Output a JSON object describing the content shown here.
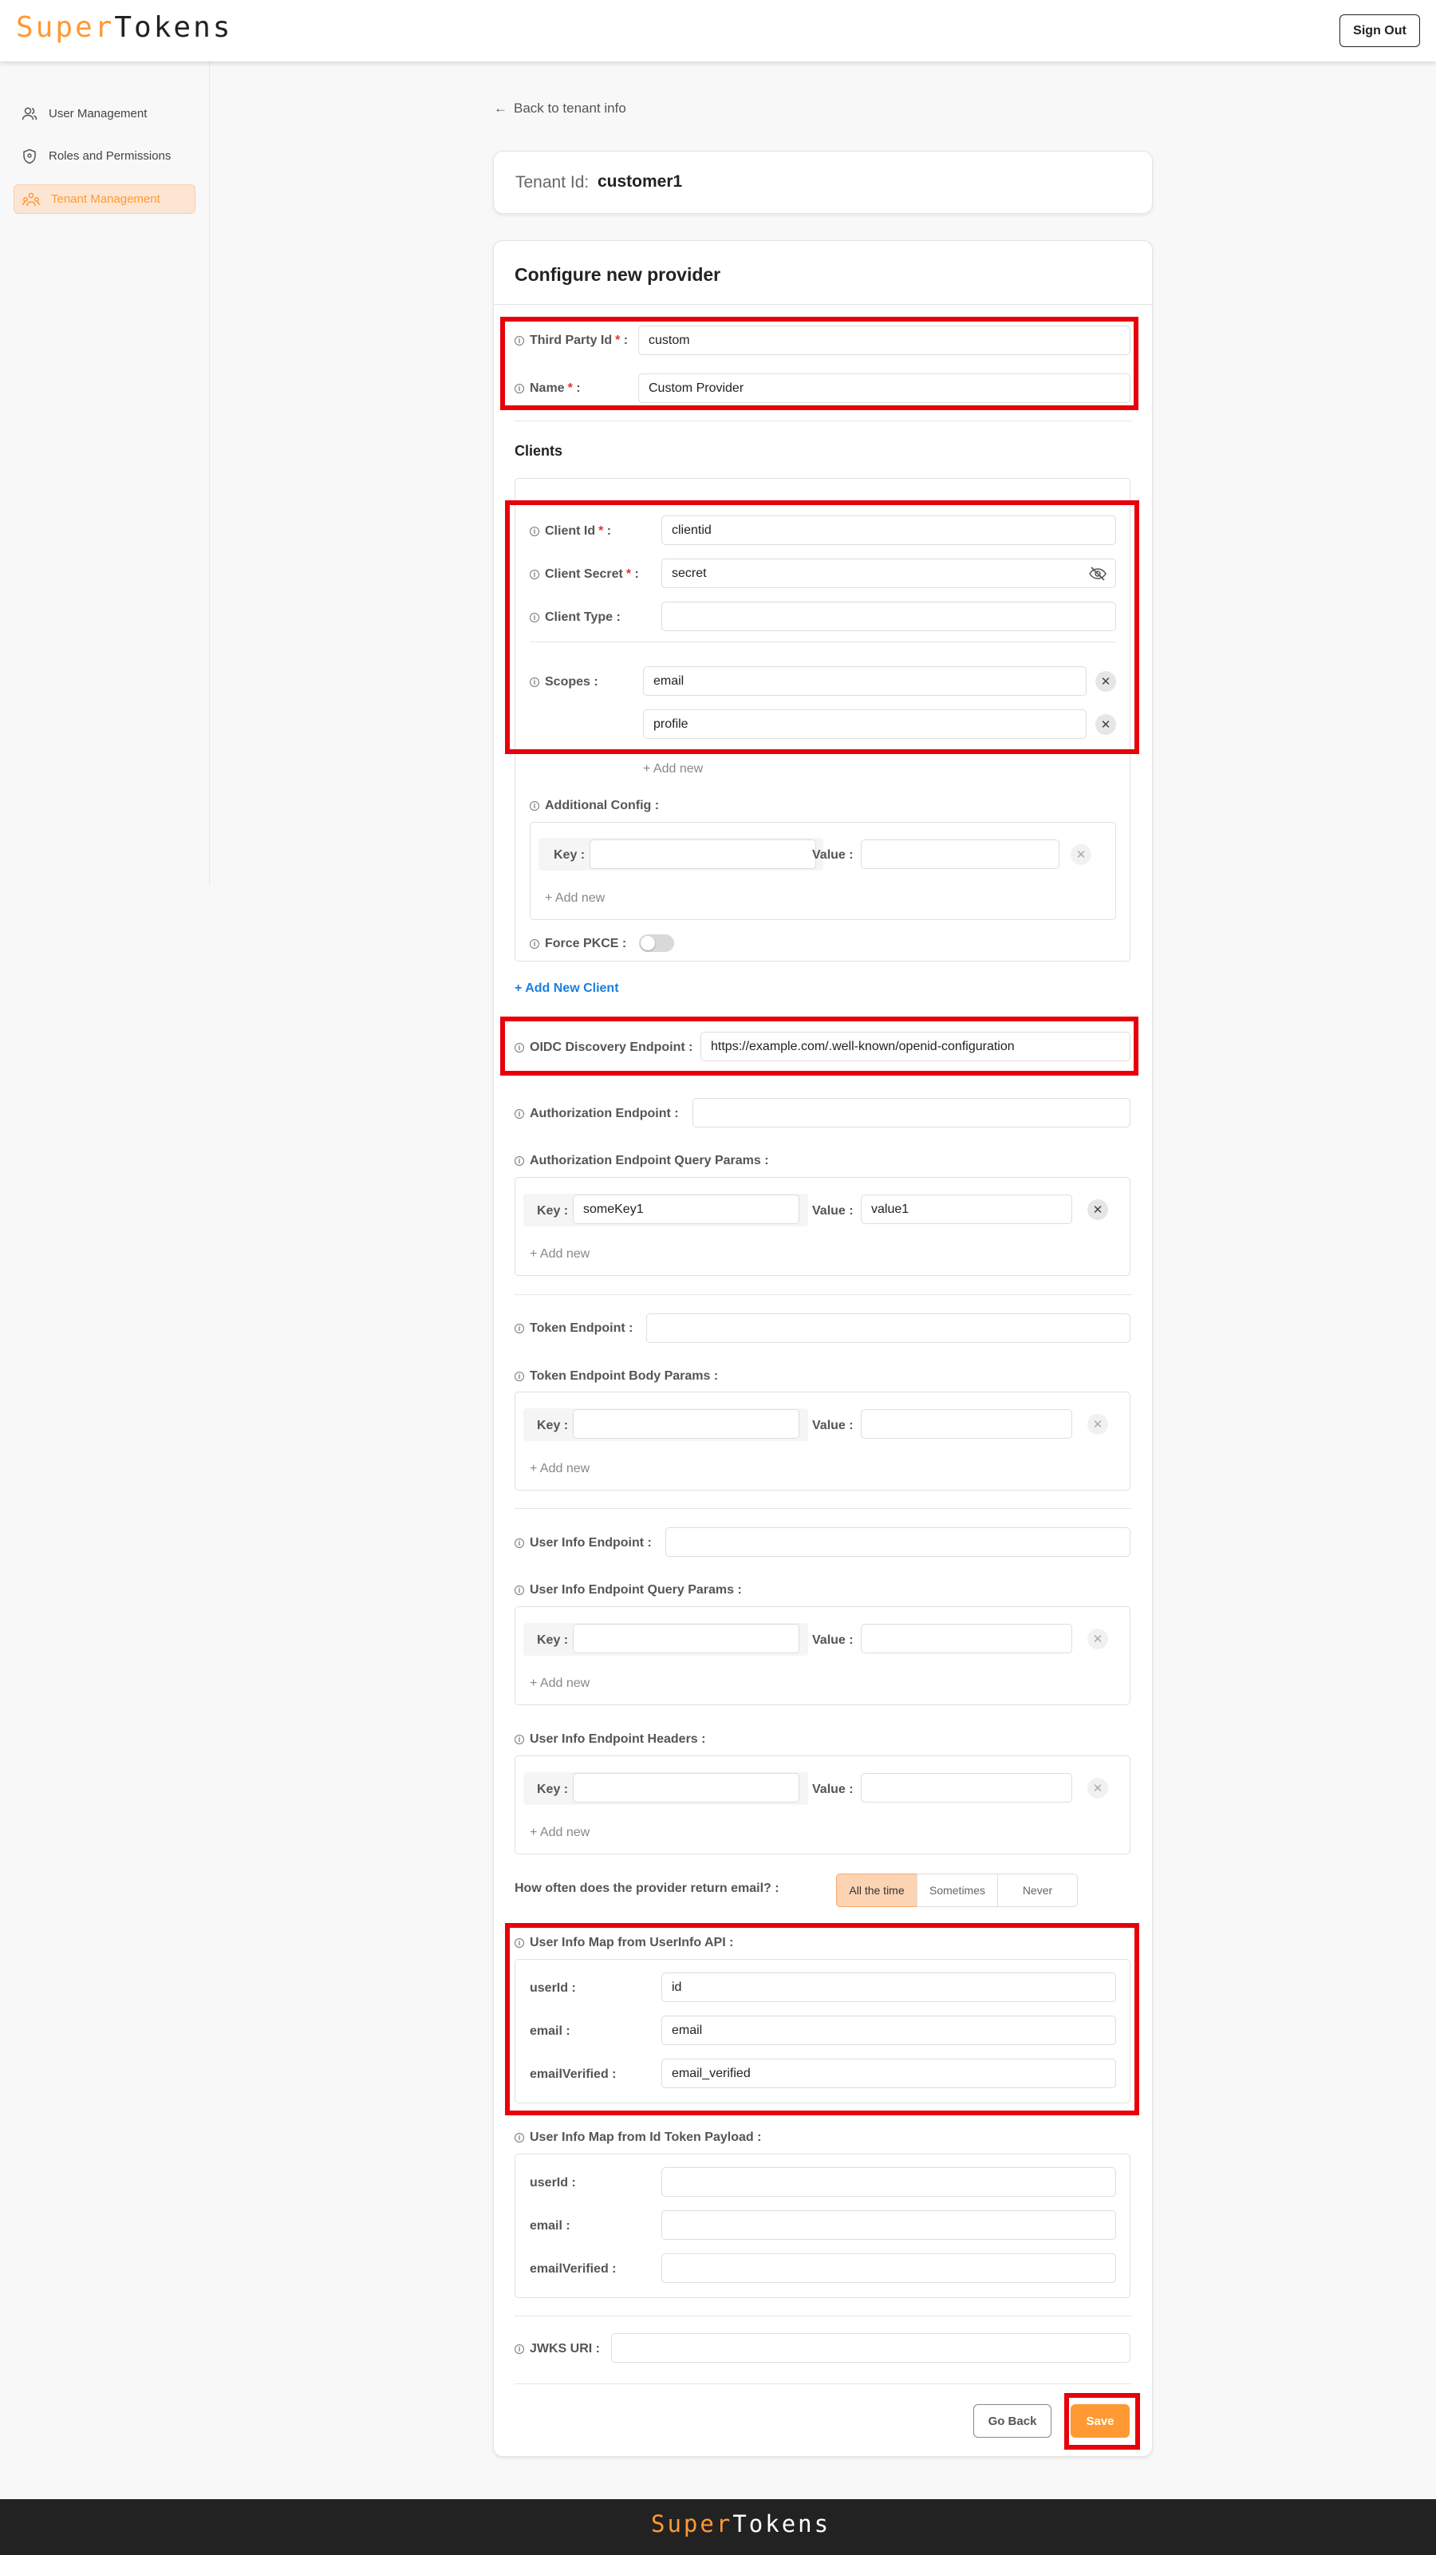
{
  "brand": {
    "super": "Super",
    "tokens": "Tokens"
  },
  "header": {
    "sign_out": "Sign Out"
  },
  "sidebar": {
    "items": [
      {
        "label": "User Management"
      },
      {
        "label": "Roles and Permissions"
      },
      {
        "label": "Tenant Management"
      }
    ]
  },
  "back_link": "Back to tenant info",
  "tenant": {
    "label": "Tenant Id:",
    "value": "customer1"
  },
  "form": {
    "title": "Configure new provider",
    "third_party_id": {
      "label": "Third Party Id",
      "value": "custom"
    },
    "name": {
      "label": "Name",
      "value": "Custom Provider"
    },
    "clients_heading": "Clients",
    "client": {
      "client_id": {
        "label": "Client Id",
        "value": "clientid"
      },
      "client_secret": {
        "label": "Client Secret",
        "value": "secret"
      },
      "client_type": {
        "label": "Client Type :",
        "value": ""
      },
      "scopes_label": "Scopes :",
      "scopes": [
        "email",
        "profile"
      ],
      "add_new": "+ Add new",
      "additional_config_label": "Additional Config :",
      "force_pkce_label": "Force PKCE :"
    },
    "add_new_client": "+ Add New Client",
    "oidc": {
      "label": "OIDC Discovery Endpoint :",
      "value": "https://example.com/.well-known/openid-configuration"
    },
    "authorization_endpoint_label": "Authorization Endpoint :",
    "authorization_query_params_label": "Authorization Endpoint Query Params :",
    "auth_param": {
      "key": "someKey1",
      "value": "value1"
    },
    "token_endpoint_label": "Token Endpoint :",
    "token_body_params_label": "Token Endpoint Body Params :",
    "user_info_endpoint_label": "User Info Endpoint :",
    "user_info_query_params_label": "User Info Endpoint Query Params :",
    "user_info_headers_label": "User Info Endpoint Headers :",
    "kv": {
      "key_label": "Key :",
      "value_label": "Value :"
    },
    "email_frequency": {
      "question": "How often does the provider return email? :",
      "options": [
        "All the time",
        "Sometimes",
        "Never"
      ],
      "selected": "All the time"
    },
    "userinfo_map": {
      "label": "User Info Map from UserInfo API :",
      "rows": [
        {
          "label": "userId :",
          "value": "id"
        },
        {
          "label": "email :",
          "value": "email"
        },
        {
          "label": "emailVerified :",
          "value": "email_verified"
        }
      ]
    },
    "idtoken_map": {
      "label": "User Info Map from Id Token Payload :",
      "rows": [
        {
          "label": "userId :",
          "value": ""
        },
        {
          "label": "email :",
          "value": ""
        },
        {
          "label": "emailVerified :",
          "value": ""
        }
      ]
    },
    "jwks_label": "JWKS URI :",
    "go_back": "Go Back",
    "save": "Save"
  },
  "colors": {
    "accent": "#ff9933",
    "highlight": "#e8000b",
    "link": "#1a7fe0"
  },
  "icons": [
    "users-icon",
    "shield-icon",
    "tenant-icon",
    "arrow-left-icon",
    "info-icon",
    "eye-slash-icon",
    "close-icon"
  ]
}
